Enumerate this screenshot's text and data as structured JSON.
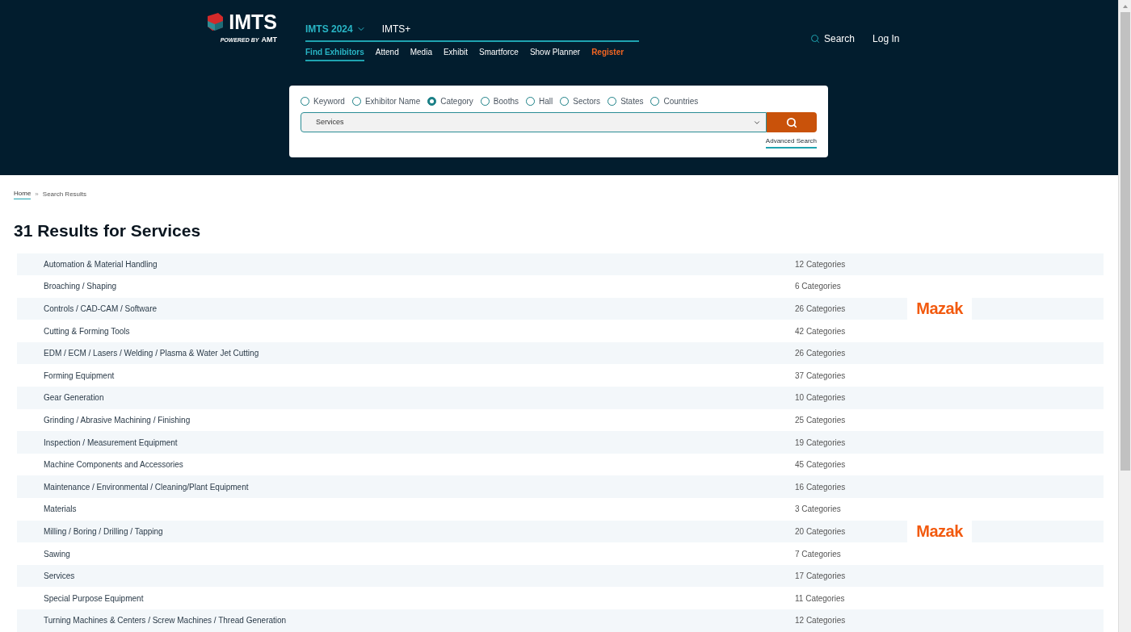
{
  "header": {
    "logo": {
      "name": "IMTS",
      "tagline": "POWERED BY",
      "partner": "AMT"
    },
    "top_nav": [
      {
        "label": "IMTS 2024",
        "selected": true,
        "dropdown": true
      },
      {
        "label": "IMTS+",
        "selected": false,
        "dropdown": false
      }
    ],
    "sub_nav": [
      {
        "label": "Find Exhibitors",
        "selected": true,
        "kind": "link"
      },
      {
        "label": "Attend",
        "selected": false,
        "kind": "link"
      },
      {
        "label": "Media",
        "selected": false,
        "kind": "link"
      },
      {
        "label": "Exhibit",
        "selected": false,
        "kind": "link"
      },
      {
        "label": "Smartforce",
        "selected": false,
        "kind": "link"
      },
      {
        "label": "Show Planner",
        "selected": false,
        "kind": "link"
      },
      {
        "label": "Register",
        "selected": false,
        "kind": "highlight"
      }
    ],
    "search_link": "Search",
    "login": "Log In"
  },
  "search_panel": {
    "options": [
      {
        "label": "Keyword",
        "selected": false
      },
      {
        "label": "Exhibitor Name",
        "selected": false
      },
      {
        "label": "Category",
        "selected": true
      },
      {
        "label": "Booths",
        "selected": false
      },
      {
        "label": "Hall",
        "selected": false
      },
      {
        "label": "Sectors",
        "selected": false
      },
      {
        "label": "States",
        "selected": false
      },
      {
        "label": "Countries",
        "selected": false
      }
    ],
    "value": "Services",
    "advanced": "Advanced Search"
  },
  "breadcrumb": [
    "Home",
    "Search Results"
  ],
  "breadcrumb_separator": "»",
  "heading": "31 Results for Services",
  "results": [
    {
      "name": "Automation & Material Handling",
      "count": "12 Categories"
    },
    {
      "name": "Broaching / Shaping",
      "count": "6 Categories"
    },
    {
      "name": "Controls / CAD-CAM / Software",
      "count": "26 Categories",
      "sponsor": "Mazak"
    },
    {
      "name": "Cutting & Forming Tools",
      "count": "42 Categories"
    },
    {
      "name": "EDM / ECM / Lasers / Welding / Plasma & Water Jet Cutting",
      "count": "26 Categories"
    },
    {
      "name": "Forming Equipment",
      "count": "37 Categories"
    },
    {
      "name": "Gear Generation",
      "count": "10 Categories"
    },
    {
      "name": "Grinding / Abrasive Machining / Finishing",
      "count": "25 Categories"
    },
    {
      "name": "Inspection / Measurement Equipment",
      "count": "19 Categories"
    },
    {
      "name": "Machine Components and Accessories",
      "count": "45 Categories"
    },
    {
      "name": "Maintenance / Environmental / Cleaning/Plant Equipment",
      "count": "16 Categories"
    },
    {
      "name": "Materials",
      "count": "3 Categories"
    },
    {
      "name": "Milling / Boring / Drilling / Tapping",
      "count": "20 Categories",
      "sponsor": "Mazak"
    },
    {
      "name": "Sawing",
      "count": "7 Categories"
    },
    {
      "name": "Services",
      "count": "17 Categories"
    },
    {
      "name": "Special Purpose Equipment",
      "count": "11 Categories"
    },
    {
      "name": "Turning Machines & Centers / Screw Machines / Thread Generation",
      "count": "12 Categories"
    }
  ]
}
